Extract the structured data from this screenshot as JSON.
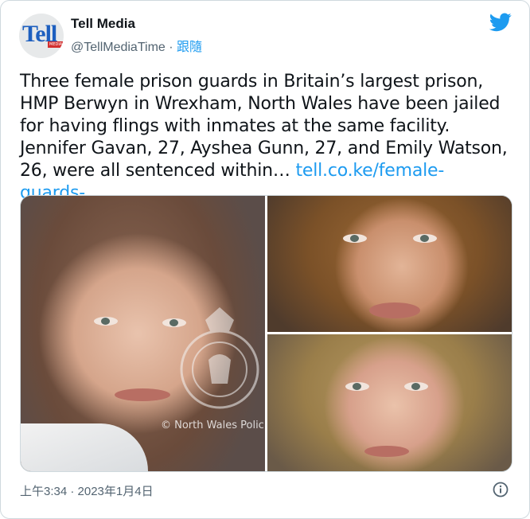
{
  "account": {
    "avatar_text": "Tell",
    "avatar_subtext": "MEDIA",
    "name": "Tell Media",
    "handle": "@TellMediaTime",
    "separator": "·",
    "follow_label": "跟隨"
  },
  "tweet": {
    "text": "Three female prison guards in Britain’s largest prison, HMP Berwyn in Wrexham, North Wales have been jailed for having flings with inmates at the same facility. Jennifer Gavan, 27, Ayshea Gunn, 27, and Emily Watson, 26, were all sentenced within… ",
    "link": "tell.co.ke/female-guards-…"
  },
  "media": {
    "watermark": "© North Wales Polic"
  },
  "footer": {
    "timestamp": "上午3:34 · 2023年1月4日"
  },
  "colors": {
    "accent": "#1d9bf0",
    "text": "#0f1419",
    "muted": "#536471",
    "border": "#cfd9de"
  },
  "icons": {
    "brand": "twitter-bird-icon",
    "info": "info-icon"
  }
}
